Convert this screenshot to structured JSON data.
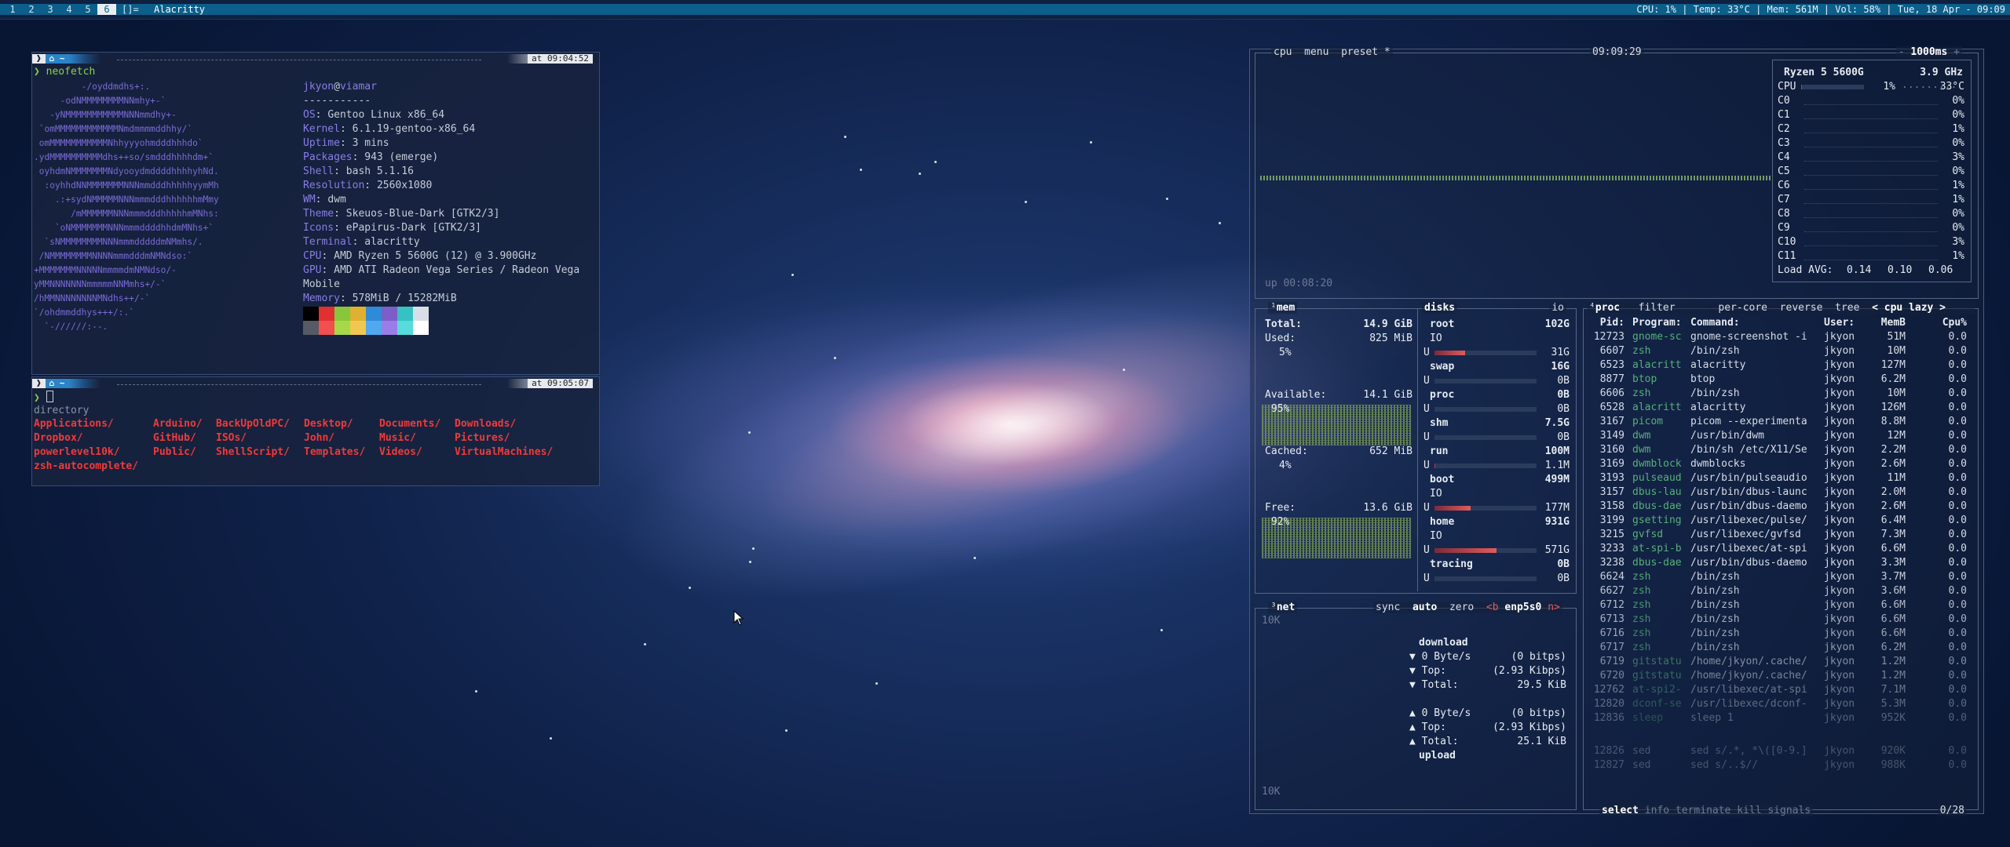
{
  "topbar": {
    "tags": [
      "1",
      "2",
      "3",
      "4",
      "5",
      "6"
    ],
    "active_tag": "6",
    "layout": "[]=",
    "window_title": "Alacritty",
    "status": "CPU: 1% | Temp: 33°C | Mem: 561M | Vol: 58% | Tue, 18 Apr - 09:09"
  },
  "term1": {
    "time": "at 09:04:52",
    "command": "neofetch",
    "user": "jkyon",
    "at": "@",
    "host": "viamar",
    "separator": "-----------",
    "info": [
      {
        "k": "OS",
        "v": "Gentoo Linux x86_64"
      },
      {
        "k": "Kernel",
        "v": "6.1.19-gentoo-x86_64"
      },
      {
        "k": "Uptime",
        "v": "3 mins"
      },
      {
        "k": "Packages",
        "v": "943 (emerge)"
      },
      {
        "k": "Shell",
        "v": "bash 5.1.16"
      },
      {
        "k": "Resolution",
        "v": "2560x1080"
      },
      {
        "k": "WM",
        "v": "dwm"
      },
      {
        "k": "Theme",
        "v": "Skeuos-Blue-Dark [GTK2/3]"
      },
      {
        "k": "Icons",
        "v": "ePapirus-Dark [GTK2/3]"
      },
      {
        "k": "Terminal",
        "v": "alacritty"
      },
      {
        "k": "CPU",
        "v": "AMD Ryzen 5 5600G (12) @ 3.900GHz"
      },
      {
        "k": "GPU",
        "v": "AMD ATI Radeon Vega Series / Radeon Vega Mobile"
      },
      {
        "k": "Memory",
        "v": "578MiB / 15282MiB"
      }
    ],
    "ascii": "         -/oyddmdhs+:.\n     -odNMMMMMMMMNNmhy+-`\n   -yNMMMMMMMMMMMNNNmmdhy+-\n `omMMMMMMMMMMMMNmdmmmmddhhy/`\n omMMMMMMMMMMMNhhyyyohmdddhhhdo`\n.ydMMMMMMMMMMdhs++so/smdddhhhhdm+`\n oyhdmNMMMMMMMNdyooydmddddhhhhyhNd.\n  :oyhhdNNMMMMMMMNNNmmdddhhhhhyymMh\n    .:+sydNMMMMMNNNmmmdddhhhhhhmMmy\n       /mMMMMMMNNNmmmdddhhhhhmMNhs:\n    `oNMMMMMMMNNNmmmddddhhdmMNhs+`\n  `sNMMMMMMMMNNNmmmdddddmNMmhs/.\n /NMMMMMMMMNNNNmmmdddmNMNdso:`\n+MMMMMMMNNNNNmmmmdmNMNdso/-\nyMMNNNNNNNmmmmmNNMmhs+/-`\n/hMMNNNNNNNNMNdhs++/-`\n`/ohdmmddhys+++/:.`\n  `-//////:--.",
    "colors": [
      "#000000",
      "#e03030",
      "#88c63c",
      "#e0b030",
      "#2f8ad8",
      "#7b5ec8",
      "#36c2c2",
      "#d8dde6",
      "#555a66",
      "#f05050",
      "#a6d84a",
      "#f0c850",
      "#50a8f0",
      "#9a7ee8",
      "#56dcdc",
      "#ffffff"
    ]
  },
  "term2": {
    "time": "at 09:05:07",
    "prompt": "❯",
    "output_header": "directory",
    "dirs": [
      "Applications/",
      "Arduino/",
      "BackUpOldPC/",
      "Desktop/",
      "Documents/",
      "Downloads/",
      "Dropbox/",
      "GitHub/",
      "ISOs/",
      "John/",
      "Music/",
      "Pictures/",
      "powerlevel10k/",
      "Public/",
      "ShellScript/",
      "Templates/",
      "Videos/",
      "VirtualMachines/",
      "zsh-autocomplete/"
    ]
  },
  "btop": {
    "cpu": {
      "tabs": [
        "cpu",
        "menu",
        "preset *"
      ],
      "clock": "09:09:29",
      "interval": "1000ms",
      "model": "Ryzen 5 5600G",
      "freq": "3.9 GHz",
      "total": {
        "name": "CPU",
        "pct": "1%",
        "temp": "33°C",
        "value": 0.01
      },
      "cores": [
        {
          "name": "C0",
          "pct": "0%"
        },
        {
          "name": "C1",
          "pct": "0%"
        },
        {
          "name": "C2",
          "pct": "1%"
        },
        {
          "name": "C3",
          "pct": "0%"
        },
        {
          "name": "C4",
          "pct": "3%"
        },
        {
          "name": "C5",
          "pct": "0%"
        },
        {
          "name": "C6",
          "pct": "1%"
        },
        {
          "name": "C7",
          "pct": "1%"
        },
        {
          "name": "C8",
          "pct": "0%"
        },
        {
          "name": "C9",
          "pct": "0%"
        },
        {
          "name": "C10",
          "pct": "3%"
        },
        {
          "name": "C11",
          "pct": "1%"
        }
      ],
      "load_label": "Load AVG:",
      "load": [
        "0.14",
        "0.10",
        "0.06"
      ],
      "uptime": "up 00:08:20"
    },
    "mem": {
      "title": "mem",
      "total_label": "Total:",
      "total": "14.9 GiB",
      "used_label": "Used:",
      "used": "825 MiB",
      "used_pct": "5%",
      "avail_label": "Available:",
      "avail": "14.1 GiB",
      "avail_pct": "95%",
      "cached_label": "Cached:",
      "cached": "652 MiB",
      "cached_pct": "4%",
      "free_label": "Free:",
      "free": "13.6 GiB",
      "free_pct": "92%"
    },
    "disks": {
      "title": "disks",
      "io": "io",
      "items": [
        {
          "name": "root",
          "size": "102G",
          "io": "IO",
          "used": "31G",
          "frac": 0.3
        },
        {
          "name": "swap",
          "size": "16G",
          "used": "0B",
          "frac": 0
        },
        {
          "name": "proc",
          "size": "0B",
          "used": "0B",
          "frac": 0
        },
        {
          "name": "shm",
          "size": "7.5G",
          "used": "0B",
          "frac": 0
        },
        {
          "name": "run",
          "size": "100M",
          "used": "1.1M",
          "frac": 0.01
        },
        {
          "name": "boot",
          "size": "499M",
          "io": "IO",
          "used": "177M",
          "frac": 0.35
        },
        {
          "name": "home",
          "size": "931G",
          "io": "IO",
          "used": "571G",
          "frac": 0.61
        },
        {
          "name": "tracing",
          "size": "0B",
          "used": "0B",
          "frac": 0
        }
      ]
    },
    "net": {
      "title": "net",
      "tabs": [
        "sync",
        "auto",
        "zero",
        "<b",
        "enp5s0",
        "n>"
      ],
      "scale_top": "10K",
      "scale_bottom": "10K",
      "download": "download",
      "dl_rate": "0 Byte/s",
      "dl_bits": "(0 bitps)",
      "dl_top_label": "Top:",
      "dl_top": "(2.93 Kibps)",
      "dl_total_label": "Total:",
      "dl_total": "29.5 KiB",
      "ul_rate": "0 Byte/s",
      "ul_bits": "(0 bitps)",
      "ul_top_label": "Top:",
      "ul_top": "(2.93 Kibps)",
      "ul_total_label": "Total:",
      "ul_total": "25.1 KiB",
      "upload": "upload"
    },
    "proc": {
      "tabs": [
        "proc",
        "filter",
        "per-core",
        "reverse",
        "tree",
        "< cpu lazy >"
      ],
      "headers": [
        "Pid:",
        "Program:",
        "Command:",
        "User:",
        "MemB",
        "Cpu%"
      ],
      "rows": [
        [
          "12723",
          "gnome-sc",
          "gnome-screenshot -i",
          "jkyon",
          "51M",
          "0.0"
        ],
        [
          "6607",
          "zsh",
          "/bin/zsh",
          "jkyon",
          "10M",
          "0.0"
        ],
        [
          "6523",
          "alacritt",
          "alacritty",
          "jkyon",
          "127M",
          "0.0"
        ],
        [
          "8877",
          "btop",
          "btop",
          "jkyon",
          "6.2M",
          "0.0"
        ],
        [
          "6606",
          "zsh",
          "/bin/zsh",
          "jkyon",
          "10M",
          "0.0"
        ],
        [
          "6528",
          "alacritt",
          "alacritty",
          "jkyon",
          "126M",
          "0.0"
        ],
        [
          "3167",
          "picom",
          "picom --experimenta",
          "jkyon",
          "8.8M",
          "0.0"
        ],
        [
          "3149",
          "dwm",
          "/usr/bin/dwm",
          "jkyon",
          "12M",
          "0.0"
        ],
        [
          "3160",
          "dwm",
          "/bin/sh /etc/X11/Se",
          "jkyon",
          "2.2M",
          "0.0"
        ],
        [
          "3169",
          "dwmblock",
          "dwmblocks",
          "jkyon",
          "2.6M",
          "0.0"
        ],
        [
          "3193",
          "pulseaud",
          "/usr/bin/pulseaudio",
          "jkyon",
          "11M",
          "0.0"
        ],
        [
          "3157",
          "dbus-lau",
          "/usr/bin/dbus-launc",
          "jkyon",
          "2.0M",
          "0.0"
        ],
        [
          "3158",
          "dbus-dae",
          "/usr/bin/dbus-daemo",
          "jkyon",
          "2.6M",
          "0.0"
        ],
        [
          "3199",
          "gsetting",
          "/usr/libexec/pulse/",
          "jkyon",
          "6.4M",
          "0.0"
        ],
        [
          "3215",
          "gvfsd",
          "/usr/libexec/gvfsd",
          "jkyon",
          "7.3M",
          "0.0"
        ],
        [
          "3233",
          "at-spi-b",
          "/usr/libexec/at-spi",
          "jkyon",
          "6.6M",
          "0.0"
        ],
        [
          "3238",
          "dbus-dae",
          "/usr/bin/dbus-daemo",
          "jkyon",
          "3.3M",
          "0.0"
        ],
        [
          "6624",
          "zsh",
          "/bin/zsh",
          "jkyon",
          "3.7M",
          "0.0"
        ],
        [
          "6627",
          "zsh",
          "/bin/zsh",
          "jkyon",
          "3.6M",
          "0.0"
        ],
        [
          "6712",
          "zsh",
          "/bin/zsh",
          "jkyon",
          "6.6M",
          "0.0"
        ],
        [
          "6713",
          "zsh",
          "/bin/zsh",
          "jkyon",
          "6.6M",
          "0.0"
        ],
        [
          "6716",
          "zsh",
          "/bin/zsh",
          "jkyon",
          "6.6M",
          "0.0"
        ],
        [
          "6717",
          "zsh",
          "/bin/zsh",
          "jkyon",
          "6.2M",
          "0.0"
        ],
        [
          "6719",
          "gitstatu",
          "/home/jkyon/.cache/",
          "jkyon",
          "1.2M",
          "0.0"
        ],
        [
          "6720",
          "gitstatu",
          "/home/jkyon/.cache/",
          "jkyon",
          "1.2M",
          "0.0"
        ],
        [
          "12762",
          "at-spi2-",
          "/usr/libexec/at-spi",
          "jkyon",
          "7.1M",
          "0.0"
        ],
        [
          "12820",
          "dconf-se",
          "/usr/libexec/dconf-",
          "jkyon",
          "5.3M",
          "0.0"
        ],
        [
          "12836",
          "sleep",
          "sleep 1",
          "jkyon",
          "952K",
          "0.0"
        ]
      ],
      "extra_rows": [
        [
          "12826",
          "sed",
          "sed s/.*, *\\([0-9.]",
          "jkyon",
          "920K",
          "0.0"
        ],
        [
          "12827",
          "sed",
          "sed s/..$//",
          "jkyon",
          "988K",
          "0.0"
        ]
      ],
      "footer_select": "select",
      "footer_items": [
        "info",
        "terminate",
        "kill",
        "signals"
      ],
      "count": "0/28"
    }
  }
}
